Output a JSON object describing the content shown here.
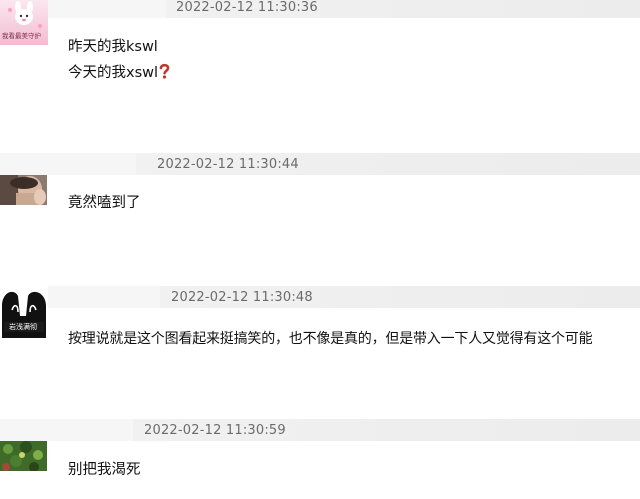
{
  "comments": [
    {
      "timestamp": "2022-02-12 11:30:36",
      "avatar_text": "我看最美守护",
      "lines": [
        "昨天的我kswl",
        "今天的我xswl"
      ],
      "emoji": "question-mark-icon"
    },
    {
      "timestamp": "2022-02-12 11:30:44",
      "lines": [
        "竟然嗑到了"
      ]
    },
    {
      "timestamp": "2022-02-12 11:30:48",
      "avatar_text": "岩浅满彻",
      "lines": [
        "按理说就是这个图看起来挺搞笑的，也不像是真的，但是带入一下人又觉得有这个可能"
      ]
    },
    {
      "timestamp": "2022-02-12 11:30:59",
      "lines": [
        "别把我渴死"
      ]
    }
  ],
  "colors": {
    "timestamp": "#6b6b6b",
    "text": "#111111",
    "bar": "#efefef",
    "emoji_red": "#c0392b"
  }
}
